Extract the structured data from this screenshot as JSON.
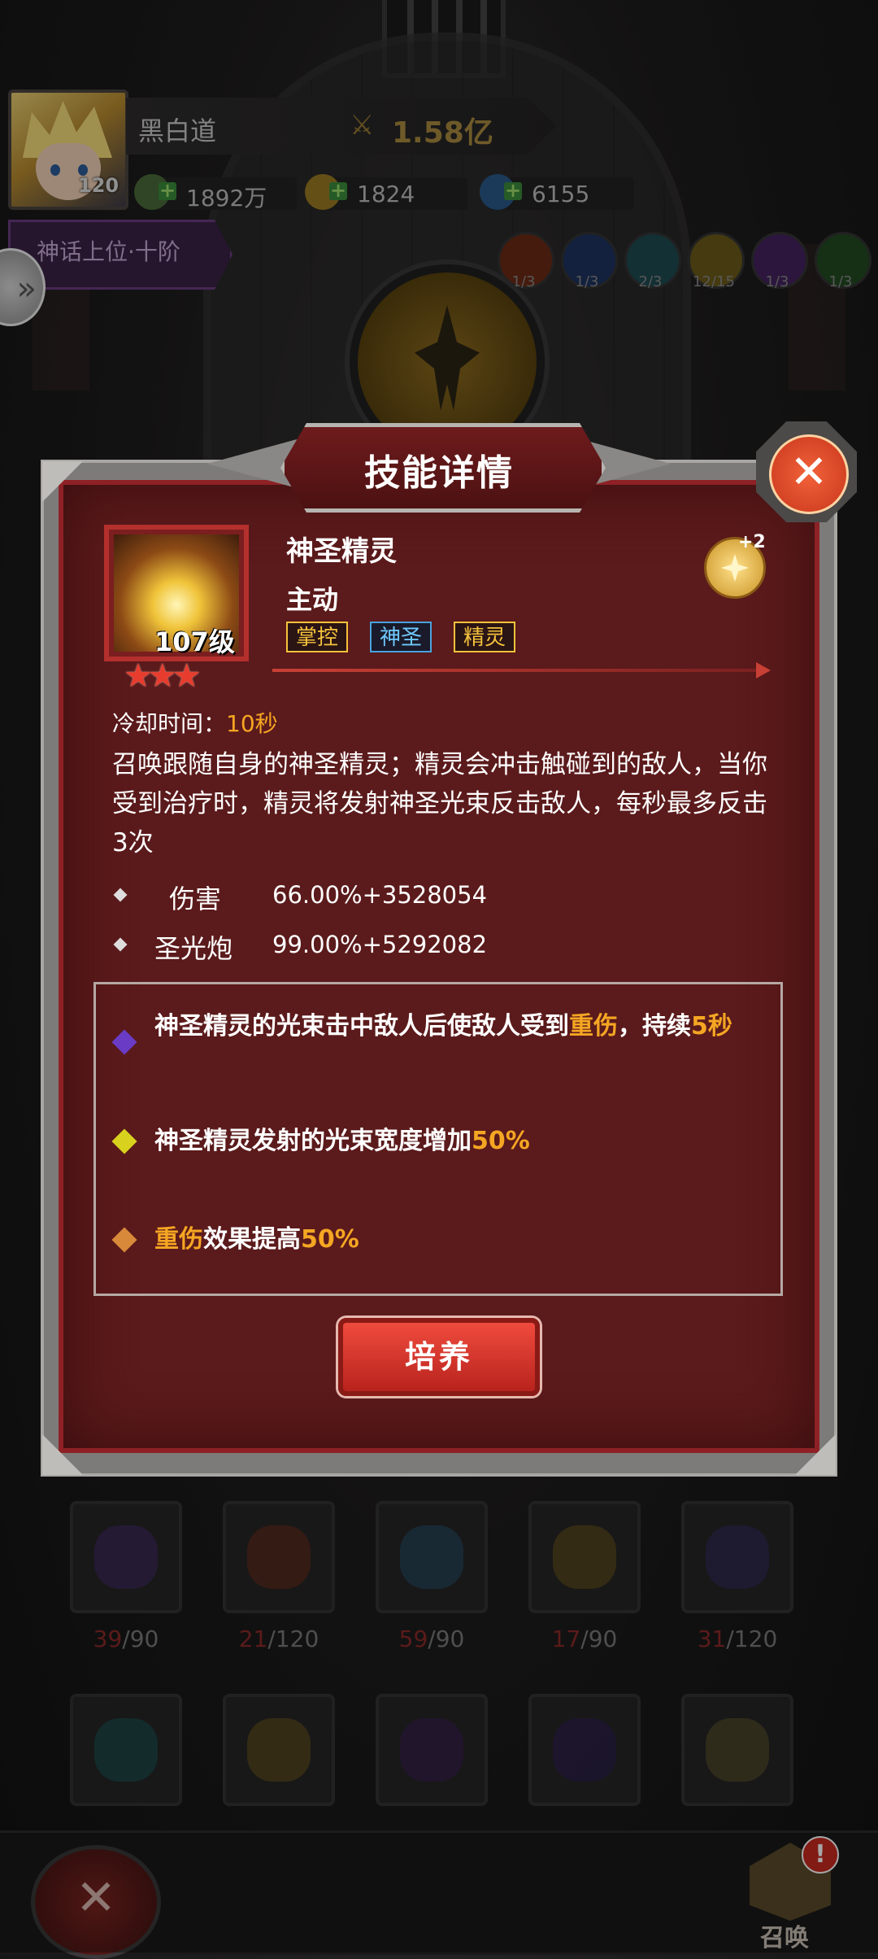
{
  "player": {
    "avatar_level": "120",
    "name": "黑白道",
    "power": "1.58亿",
    "resources": [
      {
        "name": "gold",
        "value": "1892万",
        "color": "#6fa34a"
      },
      {
        "name": "coin",
        "value": "1824",
        "color": "#d3a62a"
      },
      {
        "name": "gem",
        "value": "6155",
        "color": "#3a8fc5"
      }
    ],
    "rank": "神话上位·十阶"
  },
  "elements": [
    {
      "name": "fire",
      "count": "1/3",
      "color": "#a2401f"
    },
    {
      "name": "water",
      "count": "1/3",
      "color": "#2c4a8a"
    },
    {
      "name": "ice",
      "count": "2/3",
      "color": "#3a7a8a"
    },
    {
      "name": "holy",
      "count": "12/15",
      "color": "#a08a2a"
    },
    {
      "name": "shadow",
      "count": "1/3",
      "color": "#6a3a8a"
    },
    {
      "name": "nature",
      "count": "1/3",
      "color": "#3a7a3a"
    }
  ],
  "modal": {
    "title": "技能详情",
    "close_label": "✕",
    "skill": {
      "name": "神圣精灵",
      "type": "主动",
      "level": "107级",
      "stars": "★★★",
      "tags": [
        "掌控",
        "神圣",
        "精灵"
      ],
      "badge_plus": "+2",
      "cooldown_label": "冷却时间：",
      "cooldown_value": "10秒",
      "description": "召唤跟随自身的神圣精灵；精灵会冲击触碰到的敌人，当你受到治疗时，精灵将发射神圣光束反击敌人，每秒最多反击3次",
      "stats": [
        {
          "label": "伤害",
          "value": "66.00%+3528054"
        },
        {
          "label": "圣光炮",
          "value": "99.00%+5292082"
        }
      ],
      "traits": [
        {
          "color": "#6a3bc4",
          "pre": "神圣精灵的光束击中敌人后使敌人受到",
          "hl1": "重伤",
          "mid": "，持续",
          "hl2": "5秒",
          "post": ""
        },
        {
          "color": "#d8d21e",
          "pre": "神圣精灵发射的光束宽度增加",
          "hl1": "50%",
          "mid": "",
          "hl2": "",
          "post": ""
        },
        {
          "color": "#d8893a",
          "pre": "",
          "hl1": "重伤",
          "mid": "效果提高",
          "hl2": "50%",
          "post": ""
        }
      ]
    },
    "nurture_button": "培养"
  },
  "slots_row1": [
    {
      "icon": "purple-claw-icon",
      "current": "39",
      "max": "/90",
      "color": "#5a3a8a"
    },
    {
      "icon": "runner-icon",
      "current": "21",
      "max": "/120",
      "color": "#8a3a2a"
    },
    {
      "icon": "ice-shard-icon",
      "current": "59",
      "max": "/90",
      "color": "#3a6a8a"
    },
    {
      "icon": "golden-shield-icon",
      "current": "17",
      "max": "/90",
      "color": "#8a6a2a"
    },
    {
      "icon": "shadow-mage-icon",
      "current": "31",
      "max": "/120",
      "color": "#4a3a7a"
    }
  ],
  "slots_row2": [
    {
      "icon": "eye-icon",
      "color": "#2a6a6a"
    },
    {
      "icon": "holy-spirit-icon",
      "color": "#8a6a2a"
    },
    {
      "icon": "dark-star-icon",
      "color": "#4a2a6a"
    },
    {
      "icon": "void-orb-icon",
      "color": "#3a2a6a"
    },
    {
      "icon": "bell-icon",
      "color": "#7a6a3a"
    }
  ],
  "bottom": {
    "back_label": "✕",
    "summon_label": "召唤",
    "summon_alert": "!"
  }
}
